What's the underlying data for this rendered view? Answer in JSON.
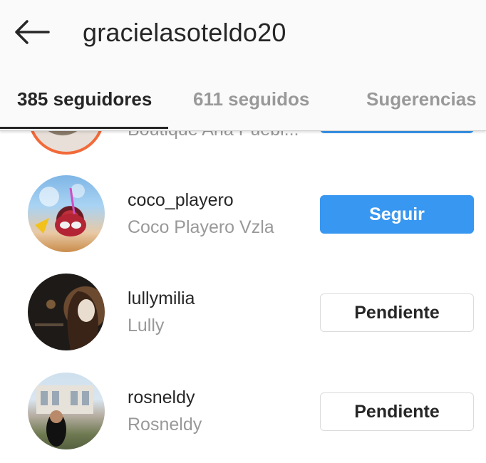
{
  "header": {
    "back_icon": "arrow-left-icon",
    "title": "gracielasoteldo20"
  },
  "tabs": [
    {
      "label": "385 seguidores",
      "active": true
    },
    {
      "label": "611 seguidos",
      "active": false
    },
    {
      "label": "Sugerencias",
      "active": false
    }
  ],
  "list": {
    "partial_row": {
      "username": "",
      "fullname": "Boutique Ana Puebl...",
      "button_label": ""
    },
    "rows": [
      {
        "username": "coco_playero",
        "fullname": "Coco Playero Vzla",
        "button_label": "Seguir",
        "button_type": "follow"
      },
      {
        "username": "lullymilia",
        "fullname": "Lully",
        "button_label": "Pendiente",
        "button_type": "pending"
      },
      {
        "username": "rosneldy",
        "fullname": "Rosneldy",
        "button_label": "Pendiente",
        "button_type": "pending"
      }
    ]
  },
  "colors": {
    "accent": "#3897f0",
    "text_primary": "#262626",
    "text_secondary": "#999999",
    "border": "#dbdbdb",
    "header_bg": "#fafafa"
  }
}
